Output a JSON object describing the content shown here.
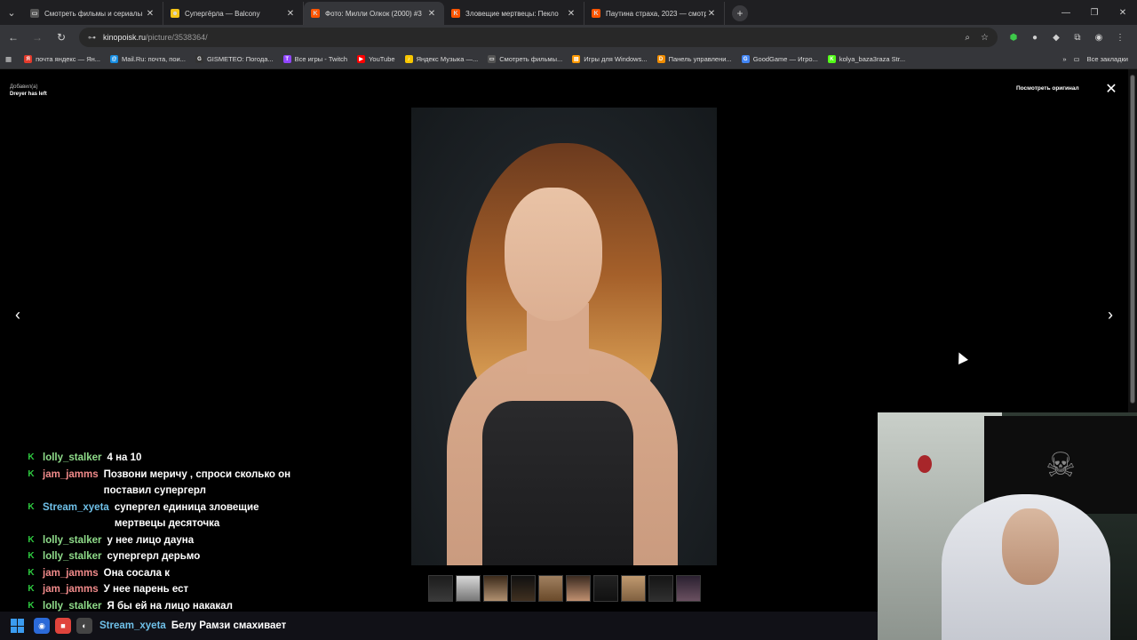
{
  "browser": {
    "tabs": [
      {
        "label": "Смотреть фильмы и сериалы",
        "active": false,
        "favicon_color": "#555555",
        "favicon_glyph": "▭"
      },
      {
        "label": "Супергёрла — Balcony",
        "active": false,
        "favicon_color": "#f5c518",
        "favicon_glyph": "☻"
      },
      {
        "label": "Фото: Милли Олкок (2000) #3",
        "active": true,
        "favicon_color": "#ff5500",
        "favicon_glyph": "K"
      },
      {
        "label": "Зловещие мертвецы: Пекло",
        "active": false,
        "favicon_color": "#ff5500",
        "favicon_glyph": "K"
      },
      {
        "label": "Паутина страха, 2023 — смотр",
        "active": false,
        "favicon_color": "#ff5500",
        "favicon_glyph": "K"
      }
    ],
    "new_tab_glyph": "+",
    "tab_close_glyph": "✕",
    "window_controls": {
      "minimize": "—",
      "restore": "❐",
      "close": "✕"
    },
    "url_host": "kinopoisk.ru",
    "url_path": "/picture/3538364/",
    "nav_icons": {
      "back": "←",
      "forward": "→",
      "reload": "↻"
    },
    "bookmarks": [
      {
        "label": "почта яндекс — Ян...",
        "color": "#e43b2c",
        "glyph": "Я"
      },
      {
        "label": "Mail.Ru: почта, пои...",
        "color": "#168de2",
        "glyph": "@"
      },
      {
        "label": "GISMETEO: Погода...",
        "color": "#333333",
        "glyph": "G"
      },
      {
        "label": "Все игры - Twitch",
        "color": "#9146ff",
        "glyph": "T"
      },
      {
        "label": "YouTube",
        "color": "#ff0000",
        "glyph": "▶"
      },
      {
        "label": "Яндекс Музыка —...",
        "color": "#f7c600",
        "glyph": "♪"
      },
      {
        "label": "Смотреть фильмы...",
        "color": "#555555",
        "glyph": "▭"
      },
      {
        "label": "Игры для Windows...",
        "color": "#ff9900",
        "glyph": "▤"
      },
      {
        "label": "Панель управлени...",
        "color": "#f08c00",
        "glyph": "D"
      },
      {
        "label": "GoodGame — Игро...",
        "color": "#4285f4",
        "glyph": "G"
      },
      {
        "label": "kolya_baza3raza Str...",
        "color": "#53fc18",
        "glyph": "K"
      }
    ],
    "all_bookmarks_label": "Все закладки"
  },
  "viewer": {
    "added_by_label": "Добавил(а)",
    "added_by_user": "Dreyer has left",
    "view_original_label": "Посмотреть оригинал",
    "close_glyph": "✕",
    "prev_glyph": "‹",
    "next_glyph": "›",
    "thumbnail_count": 10
  },
  "chat": {
    "messages": [
      {
        "user": "lolly_stalker",
        "user_color": "#8fdc8a",
        "text": "4 на 10"
      },
      {
        "user": "jam_jamms",
        "user_color": "#f08a8a",
        "text": "Позвони меричу , спроси сколько он поставил супергерл"
      },
      {
        "user": "Stream_xyeta",
        "user_color": "#6fc0e8",
        "text": "супергел единица зловещие мертвецы десяточка"
      },
      {
        "user": "lolly_stalker",
        "user_color": "#8fdc8a",
        "text": "у нее лицо дауна"
      },
      {
        "user": "lolly_stalker",
        "user_color": "#8fdc8a",
        "text": "супергерл дерьмо"
      },
      {
        "user": "jam_jamms",
        "user_color": "#f08a8a",
        "text": "Она сосала к"
      },
      {
        "user": "jam_jamms",
        "user_color": "#f08a8a",
        "text": "У нее парень ест"
      },
      {
        "user": "lolly_stalker",
        "user_color": "#8fdc8a",
        "text": "Я бы ей на лицо накакал"
      }
    ],
    "badge_glyph": "K",
    "taskbar_message": {
      "user": "Stream_xyeta",
      "text": "Белу Рамзи смахивает"
    }
  }
}
